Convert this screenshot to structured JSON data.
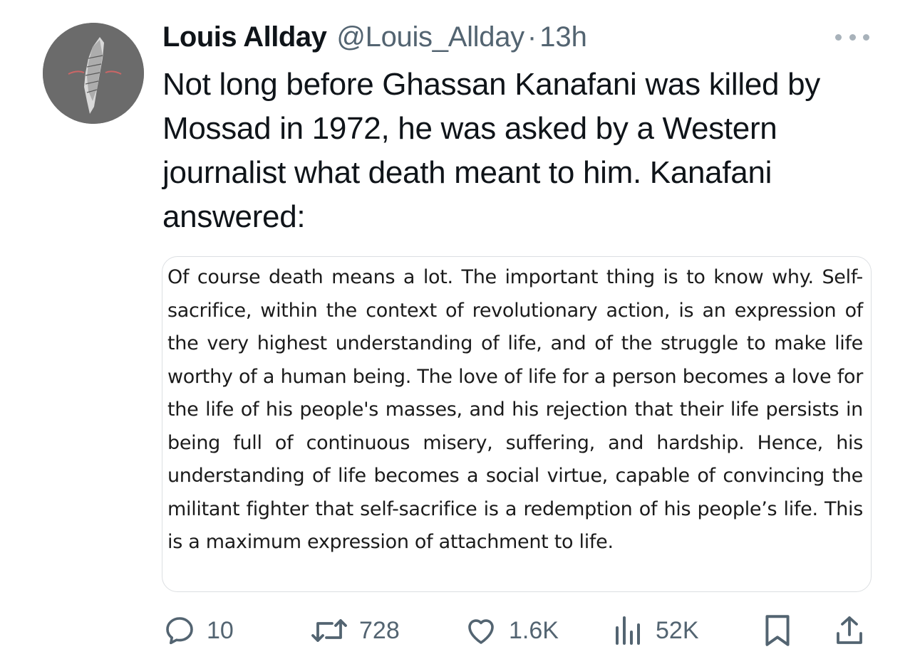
{
  "tweet": {
    "author_name": "Louis Allday",
    "author_handle": "@Louis_Allday",
    "separator": "·",
    "time": "13h",
    "text": "Not long before Ghassan Kanafani was killed by Mossad in 1972, he was asked by a Western journalist what death meant to him. Kanafani answered:",
    "quote_text": "Of course death means a lot. The important thing is to know why. Self-sacrifice, within the context of revolutionary action, is an expression of the very highest understanding of life, and of the struggle to make life worthy of a human being. The love of life for a person becomes a love for the life of his people's masses, and his rejection that their life persists in being full of continuous misery, suffering, and hardship. Hence, his understanding of life becomes a social virtue, capable of convincing the militant fighter that self-sacrifice is a redemption of his people’s life. This is a maximum expression of attachment to life."
  },
  "actions": {
    "replies": "10",
    "reposts": "728",
    "likes": "1.6K",
    "views": "52K"
  },
  "icons": {
    "more": "more-horizontal-icon",
    "reply": "reply-bubble-icon",
    "repost": "repost-icon",
    "like": "heart-icon",
    "views": "bar-chart-icon",
    "bookmark": "bookmark-icon",
    "share": "share-upload-icon"
  },
  "colors": {
    "text": "#0f1419",
    "secondary": "#536471",
    "border": "#dcdfe2",
    "avatar_bg": "#6b6b6b"
  }
}
